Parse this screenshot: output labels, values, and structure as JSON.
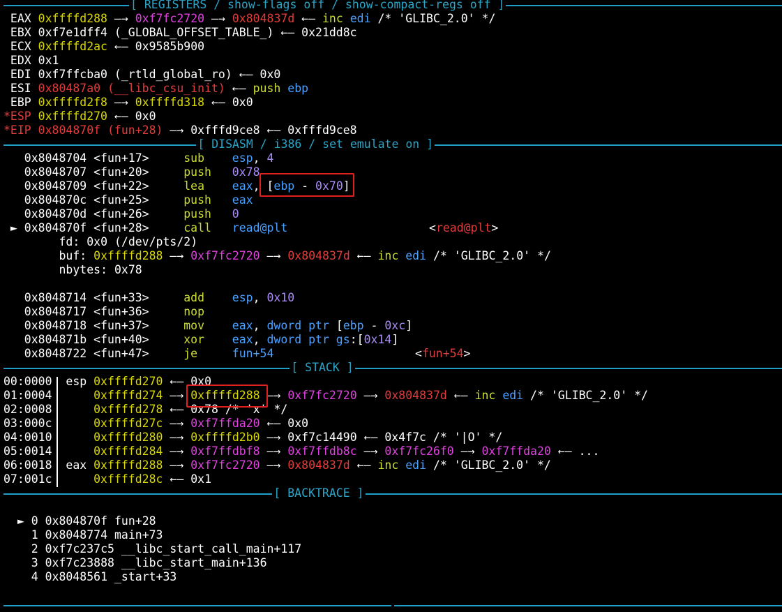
{
  "headers": {
    "registers": "[ REGISTERS / show-flags off / show-compact-regs off ]",
    "disasm": "[ DISASM / i386 / set emulate on ]",
    "stack": "[ STACK ]",
    "backtrace": "[ BACKTRACE ]"
  },
  "registers": [
    {
      "name": " EAX",
      "parts": [
        [
          "y",
          "0xffffd288"
        ],
        [
          "w",
          " —→ "
        ],
        [
          "m",
          "0xf7fc2720"
        ],
        [
          "w",
          " —→ "
        ],
        [
          "r",
          "0x804837d"
        ],
        [
          "w",
          " ←— "
        ],
        [
          "g",
          "inc "
        ],
        [
          "b",
          "edi"
        ],
        [
          "w",
          " /* 'GLIBC_2.0' */"
        ]
      ]
    },
    {
      "name": " EBX",
      "parts": [
        [
          "w",
          "0xf7e1dff4 (_GLOBAL_OFFSET_TABLE_) ←— 0x21dd8c"
        ]
      ]
    },
    {
      "name": " ECX",
      "parts": [
        [
          "y",
          "0xffffd2ac"
        ],
        [
          "w",
          " ←— 0x9585b900"
        ]
      ]
    },
    {
      "name": " EDX",
      "parts": [
        [
          "w",
          "0x1"
        ]
      ]
    },
    {
      "name": " EDI",
      "parts": [
        [
          "w",
          "0xf7ffcba0 (_rtld_global_ro) ←— 0x0"
        ]
      ]
    },
    {
      "name": " ESI",
      "parts": [
        [
          "r",
          "0x80487a0 (__libc_csu_init)"
        ],
        [
          "w",
          " ←— "
        ],
        [
          "g",
          "push "
        ],
        [
          "b",
          "ebp"
        ]
      ]
    },
    {
      "name": " EBP",
      "parts": [
        [
          "y",
          "0xffffd2f8"
        ],
        [
          "w",
          " —→ "
        ],
        [
          "y",
          "0xffffd318"
        ],
        [
          "w",
          " ←— 0x0"
        ]
      ]
    },
    {
      "name": "*ESP",
      "changed": true,
      "parts": [
        [
          "y",
          "0xffffd270"
        ],
        [
          "w",
          " ←— 0x0"
        ]
      ]
    },
    {
      "name": "*EIP",
      "changed": true,
      "parts": [
        [
          "r",
          "0x804870f (fun+28)"
        ],
        [
          "w",
          " —→ 0xfffd9ce8 ←— 0xfffd9ce8"
        ]
      ]
    }
  ],
  "disasm": [
    {
      "addr": "0x8048704",
      "sym": "<fun+17>",
      "mn": "sub",
      "ops": [
        [
          "b",
          "esp"
        ],
        [
          "w",
          ", "
        ],
        [
          "v",
          "4"
        ]
      ]
    },
    {
      "addr": "0x8048707",
      "sym": "<fun+20>",
      "mn": "push",
      "ops": [
        [
          "v",
          "0x78"
        ]
      ]
    },
    {
      "addr": "0x8048709",
      "sym": "<fun+22>",
      "mn": "lea",
      "ops": [
        [
          "b",
          "eax"
        ],
        [
          "w",
          ", "
        ],
        [
          "w",
          "["
        ],
        [
          "b",
          "ebp"
        ],
        [
          "w",
          " - "
        ],
        [
          "v",
          "0x70"
        ],
        [
          "w",
          "]"
        ]
      ]
    },
    {
      "addr": "0x804870c",
      "sym": "<fun+25>",
      "mn": "push",
      "ops": [
        [
          "b",
          "eax"
        ]
      ]
    },
    {
      "addr": "0x804870d",
      "sym": "<fun+26>",
      "mn": "push",
      "ops": [
        [
          "v",
          "0"
        ]
      ]
    },
    {
      "addr": "0x804870f",
      "sym": "<fun+28>",
      "mn": "call",
      "current": true,
      "ops": [
        [
          "b",
          "read@plt"
        ]
      ],
      "target": "read@plt"
    }
  ],
  "call_args": [
    {
      "label": "fd:",
      "parts": [
        [
          "w",
          " 0x0 (/dev/pts/2)"
        ]
      ]
    },
    {
      "label": "buf:",
      "parts": [
        [
          "w",
          " "
        ],
        [
          "y",
          "0xffffd288"
        ],
        [
          "w",
          " —→ "
        ],
        [
          "m",
          "0xf7fc2720"
        ],
        [
          "w",
          " —→ "
        ],
        [
          "r",
          "0x804837d"
        ],
        [
          "w",
          " ←— "
        ],
        [
          "g",
          "inc "
        ],
        [
          "b",
          "edi"
        ],
        [
          "w",
          " /* 'GLIBC_2.0' */"
        ]
      ]
    },
    {
      "label": "nbytes:",
      "parts": [
        [
          "w",
          " 0x78"
        ]
      ]
    }
  ],
  "disasm2": [
    {
      "addr": "0x8048714",
      "sym": "<fun+33>",
      "mn": "add",
      "ops": [
        [
          "b",
          "esp"
        ],
        [
          "w",
          ", "
        ],
        [
          "v",
          "0x10"
        ]
      ]
    },
    {
      "addr": "0x8048717",
      "sym": "<fun+36>",
      "mn": "nop",
      "ops": []
    },
    {
      "addr": "0x8048718",
      "sym": "<fun+37>",
      "mn": "mov",
      "ops": [
        [
          "b",
          "eax"
        ],
        [
          "w",
          ", "
        ],
        [
          "b",
          "dword ptr "
        ],
        [
          "w",
          "["
        ],
        [
          "b",
          "ebp"
        ],
        [
          "w",
          " - "
        ],
        [
          "v",
          "0xc"
        ],
        [
          "w",
          "]"
        ]
      ]
    },
    {
      "addr": "0x804871b",
      "sym": "<fun+40>",
      "mn": "xor",
      "ops": [
        [
          "b",
          "eax"
        ],
        [
          "w",
          ", "
        ],
        [
          "b",
          "dword ptr gs"
        ],
        [
          "w",
          ":["
        ],
        [
          "v",
          "0x14"
        ],
        [
          "w",
          "]"
        ]
      ]
    },
    {
      "addr": "0x8048722",
      "sym": "<fun+47>",
      "mn": "je",
      "ops": [
        [
          "b",
          "fun+54"
        ]
      ],
      "target": "fun+54"
    }
  ],
  "stack": [
    {
      "idx": "00:0000",
      "reg": "esp",
      "parts": [
        [
          "y",
          "0xffffd270"
        ],
        [
          "w",
          " ←— 0x0"
        ]
      ]
    },
    {
      "idx": "01:0004",
      "reg": "",
      "parts": [
        [
          "y",
          "0xffffd274"
        ],
        [
          "w",
          " —→ "
        ],
        [
          "y",
          "0xffffd288"
        ],
        [
          "w",
          " —→ "
        ],
        [
          "m",
          "0xf7fc2720"
        ],
        [
          "w",
          " —→ "
        ],
        [
          "r",
          "0x804837d"
        ],
        [
          "w",
          " ←— "
        ],
        [
          "g",
          "inc "
        ],
        [
          "b",
          "edi"
        ],
        [
          "w",
          " /* 'GLIBC_2.0' */"
        ]
      ]
    },
    {
      "idx": "02:0008",
      "reg": "",
      "parts": [
        [
          "y",
          "0xffffd278"
        ],
        [
          "w",
          " ←— 0x78 /* 'x' */"
        ]
      ]
    },
    {
      "idx": "03:000c",
      "reg": "",
      "parts": [
        [
          "y",
          "0xffffd27c"
        ],
        [
          "w",
          " —→ "
        ],
        [
          "m",
          "0xf7ffda20"
        ],
        [
          "w",
          " ←— 0x0"
        ]
      ]
    },
    {
      "idx": "04:0010",
      "reg": "",
      "parts": [
        [
          "y",
          "0xffffd280"
        ],
        [
          "w",
          " —→ "
        ],
        [
          "y",
          "0xffffd2b0"
        ],
        [
          "w",
          " —→ 0xf7c14490 ←— 0x4f7c /* '|O' */"
        ]
      ]
    },
    {
      "idx": "05:0014",
      "reg": "",
      "parts": [
        [
          "y",
          "0xffffd284"
        ],
        [
          "w",
          " —→ "
        ],
        [
          "m",
          "0xf7ffdbf8"
        ],
        [
          "w",
          " —→ "
        ],
        [
          "m",
          "0xf7ffdb8c"
        ],
        [
          "w",
          " —→ "
        ],
        [
          "m",
          "0xf7fc26f0"
        ],
        [
          "w",
          " —→ "
        ],
        [
          "m",
          "0xf7ffda20"
        ],
        [
          "w",
          " ←— ..."
        ]
      ]
    },
    {
      "idx": "06:0018",
      "reg": "eax",
      "parts": [
        [
          "y",
          "0xffffd288"
        ],
        [
          "w",
          " —→ "
        ],
        [
          "m",
          "0xf7fc2720"
        ],
        [
          "w",
          " —→ "
        ],
        [
          "r",
          "0x804837d"
        ],
        [
          "w",
          " ←— "
        ],
        [
          "g",
          "inc "
        ],
        [
          "b",
          "edi"
        ],
        [
          "w",
          " /* 'GLIBC_2.0' */"
        ]
      ]
    },
    {
      "idx": "07:001c",
      "reg": "",
      "parts": [
        [
          "y",
          "0xffffd28c"
        ],
        [
          "w",
          " ←— 0x1"
        ]
      ]
    }
  ],
  "backtrace": [
    {
      "mark": " ► ",
      "text": "0 0x804870f fun+28"
    },
    {
      "mark": "   ",
      "text": "1 0x8048774 main+73"
    },
    {
      "mark": "   ",
      "text": "2 0xf7c237c5 __libc_start_call_main+117"
    },
    {
      "mark": "   ",
      "text": "3 0xf7c23888 __libc_start_main+136"
    },
    {
      "mark": "   ",
      "text": "4 0x8048561 _start+33"
    }
  ],
  "current_marker": "►"
}
